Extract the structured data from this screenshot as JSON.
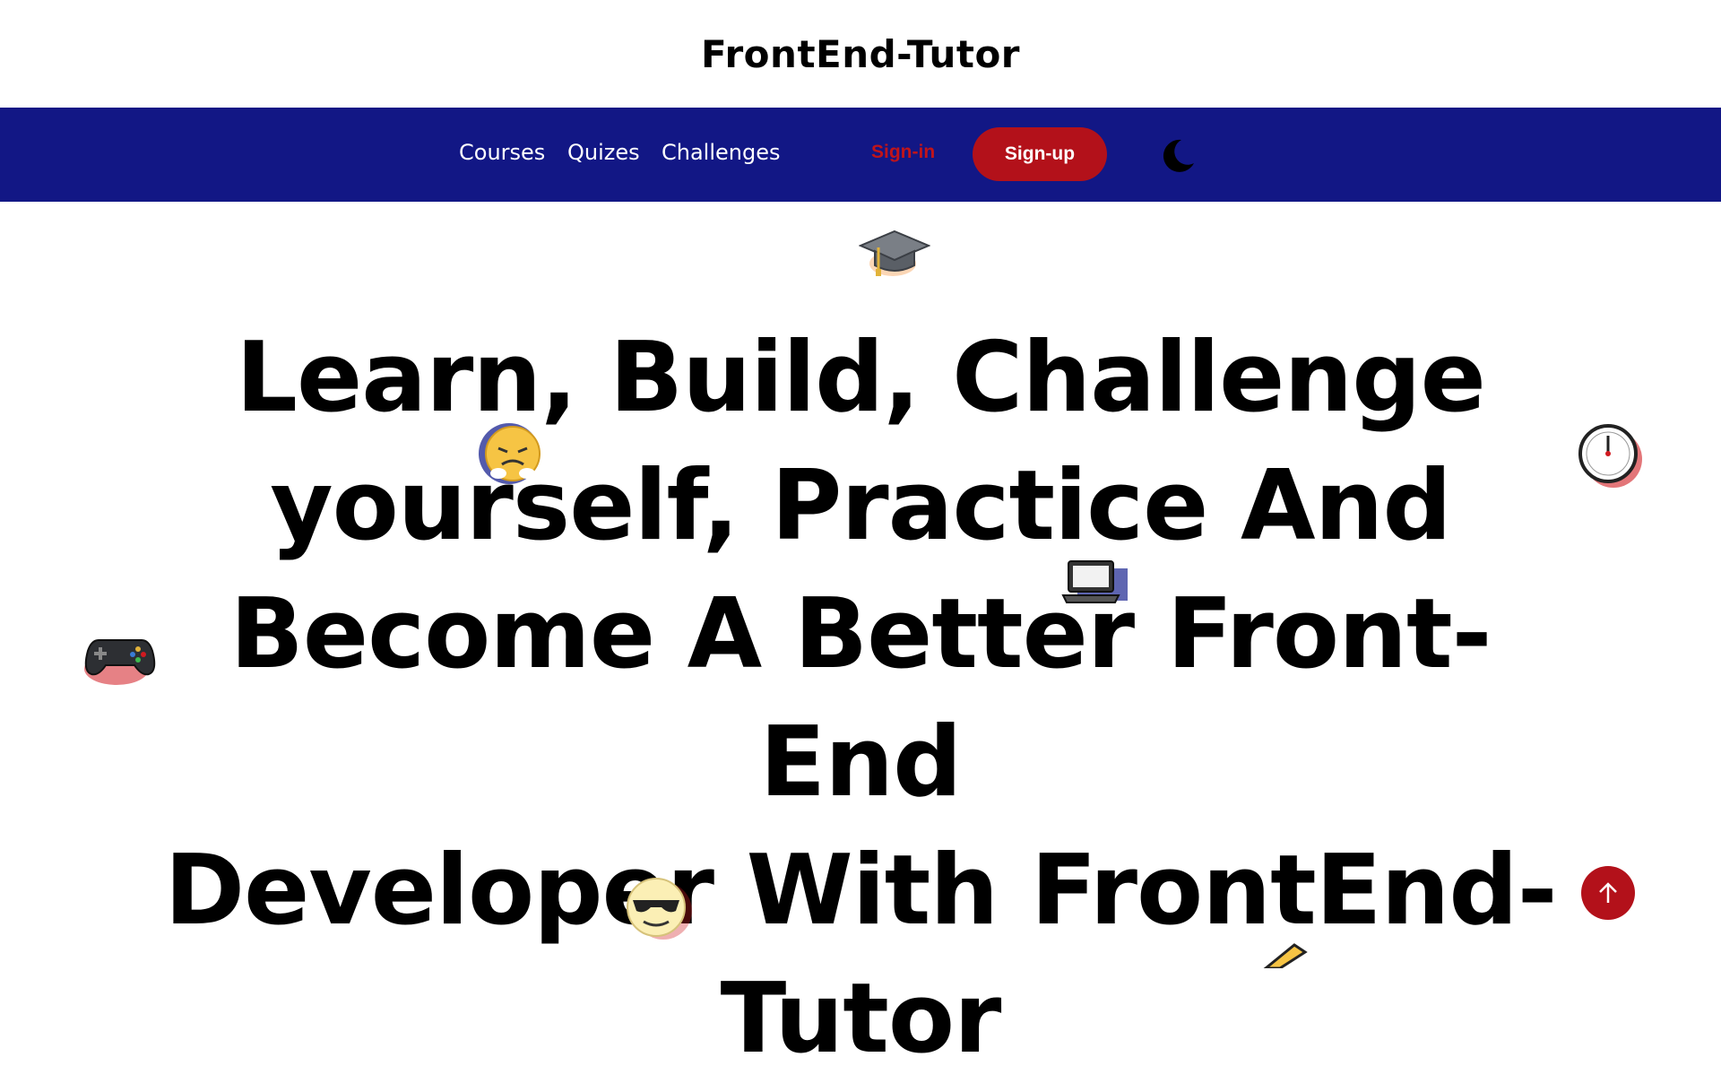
{
  "header": {
    "brand": "FrontEnd-Tutor"
  },
  "nav": {
    "links": [
      "Courses",
      "Quizes",
      "Challenges"
    ],
    "signin_label": "Sign-in",
    "signup_label": "Sign-up",
    "theme_icon": "moon-icon"
  },
  "hero": {
    "line1": "Learn, Build, Challenge",
    "line2": "yourself, Practice And",
    "line3": "Become A Better Front-End",
    "line4": "Developer With FrontEnd-",
    "line5": "Tutor"
  },
  "decorations": {
    "icons": [
      "graduation-cap-icon",
      "angry-face-icon",
      "stopwatch-icon",
      "laptop-icon",
      "game-controller-icon",
      "sunglasses-face-icon",
      "pencil-icon"
    ]
  },
  "colors": {
    "navbar": "#121785",
    "accent": "#b3111a",
    "text": "#000000"
  },
  "scroll_top_icon": "arrow-up-icon"
}
